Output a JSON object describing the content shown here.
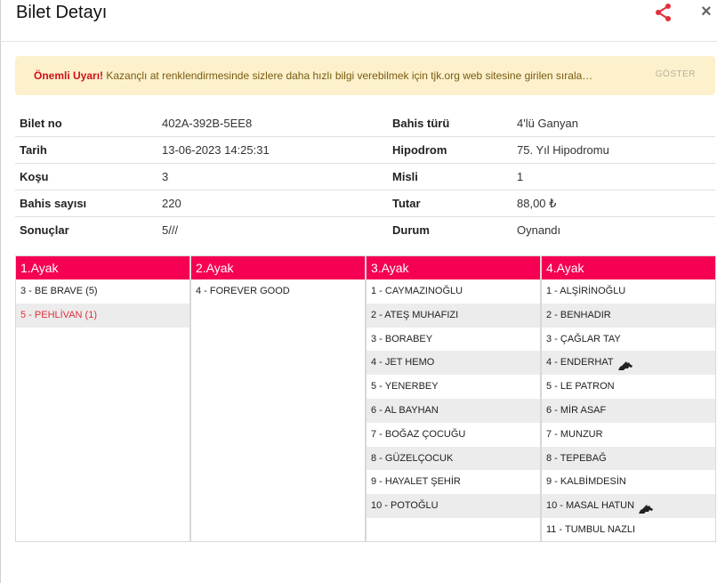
{
  "header": {
    "title": "Bilet Detayı",
    "close_label": "×"
  },
  "alert": {
    "strong": "Önemli Uyarı!",
    "text": " Kazançlı at renklendirmesinde sizlere daha hızlı bilgi verebilmek için tjk.org web sitesine girilen sırala…",
    "button": "GÖSTER"
  },
  "info": [
    {
      "k1": "Bilet no",
      "v1": "402A-392B-5EE8",
      "k2": "Bahis türü",
      "v2": "4'lü Ganyan"
    },
    {
      "k1": "Tarih",
      "v1": "13-06-2023 14:25:31",
      "k2": "Hipodrom",
      "v2": "75. Yıl Hipodromu"
    },
    {
      "k1": "Koşu",
      "v1": "3",
      "k2": "Misli",
      "v2": "1"
    },
    {
      "k1": "Bahis sayısı",
      "v1": "220",
      "k2": "Tutar",
      "v2": "88,00 ₺"
    },
    {
      "k1": "Sonuçlar",
      "v1": "5///",
      "k2": "Durum",
      "v2": "Oynandı"
    }
  ],
  "legs": [
    {
      "title": "1.Ayak",
      "horses": [
        "3 - BE BRAVE (5)",
        "5 - PEHLİVAN (1)"
      ],
      "highlighted": [
        1
      ]
    },
    {
      "title": "2.Ayak",
      "horses": [
        "4 - FOREVER GOOD"
      ],
      "highlighted": []
    },
    {
      "title": "3.Ayak",
      "horses": [
        "1 - CAYMAZINOĞLU",
        "2 - ATEŞ MUHAFIZI",
        "3 - BORABEY",
        "4 - JET HEMO",
        "5 - YENERBEY",
        "6 - AL BAYHAN",
        "7 - BOĞAZ ÇOCUĞU",
        "8 - GÜZELÇOCUK",
        "9 - HAYALET ŞEHİR",
        "10 - POTOĞLU"
      ],
      "highlighted": []
    },
    {
      "title": "4.Ayak",
      "horses": [
        "1 - ALŞİRİNOĞLU",
        "2 - BENHADIR",
        "3 - ÇAĞLAR TAY",
        "4 - ENDERHAT",
        "5 - LE PATRON",
        "6 - MİR ASAF",
        "7 - MUNZUR",
        "8 - TEPEBAĞ",
        "9 - KALBİMDESİN",
        "10 - MASAL HATUN",
        "11 - TUMBUL NAZLI"
      ],
      "highlighted": [],
      "horse_icon_rows": [
        3,
        9
      ]
    }
  ],
  "colors": {
    "accent": "#f50052",
    "share": "#e0303a",
    "alert_bg": "#fcf1cc"
  }
}
